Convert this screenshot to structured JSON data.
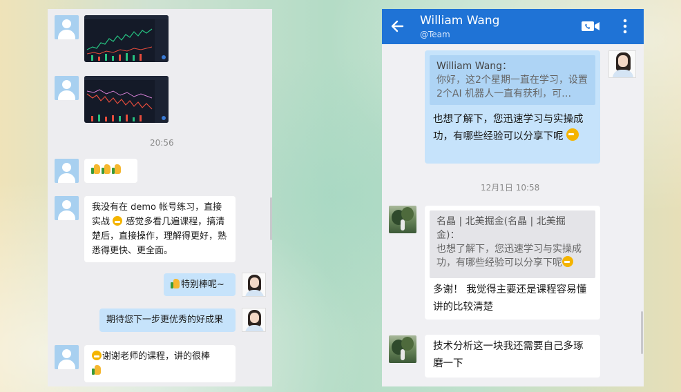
{
  "left_chat": {
    "time_divider": "20:56",
    "messages": {
      "m1_thumbs": "👍👍👍",
      "m2_text_a": "我没有在 demo 帐号练习，直接实战",
      "m2_text_b": "感觉多看几遍课程，搞清楚后，直接操作，理解得更好，熟悉得更快、更全面。",
      "m3_text": "特别棒呢~",
      "m4_text": "期待您下一步更优秀的好成果",
      "m5_text": "谢谢老师的课程，讲的很棒"
    }
  },
  "right_chat": {
    "header": {
      "title": "William Wang",
      "subtitle": "@Team"
    },
    "msg1": {
      "quote_name": "William Wang：",
      "quote_text": "你好，这2个星期一直在学习，设置2个AI 机器人一直有获利，可…",
      "reply": "也想了解下，您迅速学习与实操成功，有哪些经验可以分享下呢"
    },
    "time_divider": "12月1日  10:58",
    "msg2": {
      "quote_name": "名晶 | 北美掘金(名晶 | 北美掘金)：",
      "quote_text": "也想了解下，您迅速学习与实操成功，有哪些经验可以分享下呢",
      "reply": "多谢！ 我觉得主要还是课程容易懂讲的比较清楚"
    },
    "msg3": {
      "text": "技术分析这一块我还需要自己多琢磨一下"
    }
  },
  "colors": {
    "header_blue": "#1f73d6",
    "own_bubble": "#c6e3fb",
    "other_bubble": "#ffffff"
  }
}
